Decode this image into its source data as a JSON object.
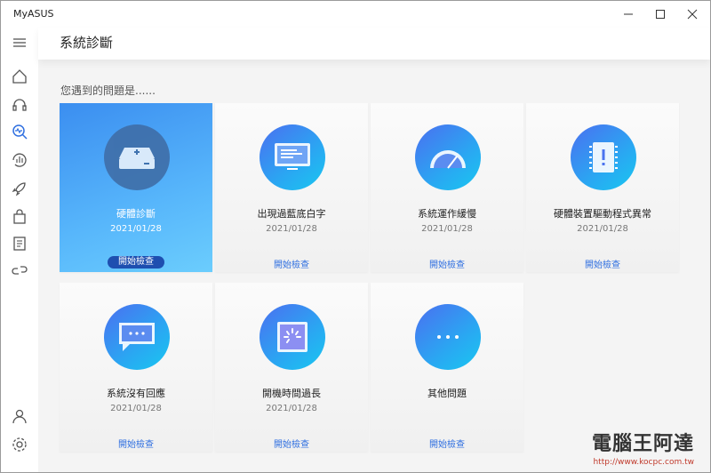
{
  "window": {
    "title": "MyASUS"
  },
  "header": {
    "title": "系統診斷"
  },
  "prompt": "您遇到的問題是......",
  "check_label": "開始檢查",
  "cards": [
    {
      "name": "硬體診斷",
      "date": "2021/01/28",
      "icon": "drive-icon",
      "active": true
    },
    {
      "name": "出現過藍底白字",
      "date": "2021/01/28",
      "icon": "monitor-icon"
    },
    {
      "name": "系統運作緩慢",
      "date": "2021/01/28",
      "icon": "speedometer-icon"
    },
    {
      "name": "硬體裝置驅動程式異常",
      "date": "2021/01/28",
      "icon": "chip-warning-icon"
    },
    {
      "name": "系統沒有回應",
      "date": "2021/01/28",
      "icon": "chat-bubble-icon"
    },
    {
      "name": "開機時間過長",
      "date": "2021/01/28",
      "icon": "loading-screen-icon"
    },
    {
      "name": "其他問題",
      "date": "",
      "icon": "more-icon"
    }
  ],
  "sidebar": [
    "menu-icon",
    "home-icon",
    "headset-icon",
    "diagnosis-icon",
    "performance-icon",
    "rocket-icon",
    "shopping-bag-icon",
    "news-icon",
    "link-icon",
    "user-icon",
    "settings-icon"
  ],
  "watermark": {
    "text": "電腦王阿達",
    "url": "http://www.kocpc.com.tw"
  },
  "accent": "#2f6fe0"
}
